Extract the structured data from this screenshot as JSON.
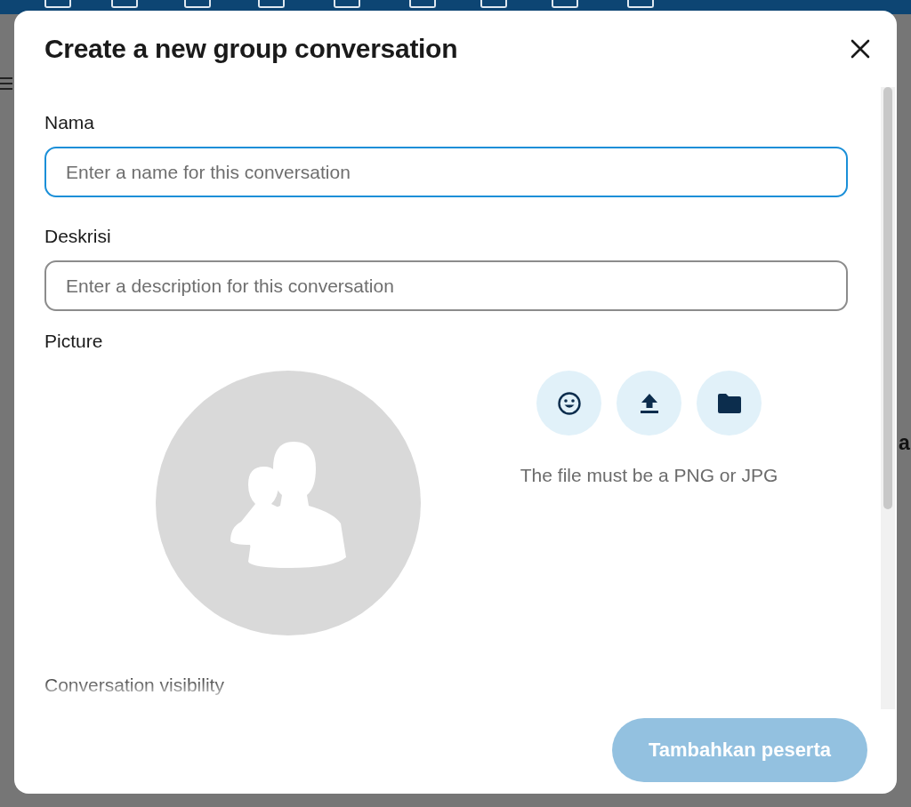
{
  "background": {
    "fragment": "a"
  },
  "dialog": {
    "title": "Create a new group conversation",
    "fields": [
      {
        "label": "Nama",
        "placeholder": "Enter a name for this conversation",
        "focused": true
      },
      {
        "label": "Deskrisi",
        "placeholder": "Enter a description for this conversation",
        "focused": false
      }
    ],
    "picture": {
      "label": "Picture",
      "actions": [
        {
          "kind": "emoji"
        },
        {
          "kind": "upload"
        },
        {
          "kind": "folder"
        }
      ],
      "hint": "The file must be a PNG or JPG"
    },
    "visibility_label": "Conversation visibility",
    "submit": {
      "label": "Tambahkan peserta",
      "disabled": true
    }
  }
}
